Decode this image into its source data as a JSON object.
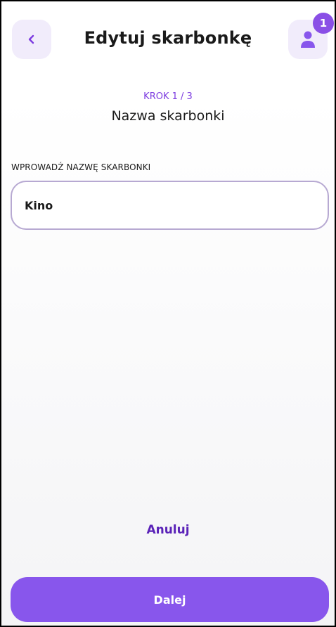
{
  "header": {
    "title": "Edytuj skarbonkę",
    "notification_count": "1"
  },
  "step": {
    "indicator": "KROK 1 / 3",
    "title": "Nazwa skarbonki"
  },
  "form": {
    "label": "WPROWADŹ NAZWĘ SKARBONKI",
    "value": "Kino"
  },
  "actions": {
    "cancel": "Anuluj",
    "next": "Dalej"
  },
  "colors": {
    "accent": "#8856ec",
    "accent_dark": "#5a22b8",
    "icon_bg": "#f1ecfb",
    "input_border": "#b7a9d2"
  },
  "icons": {
    "back": "chevron-left-icon",
    "profile": "user-icon"
  }
}
